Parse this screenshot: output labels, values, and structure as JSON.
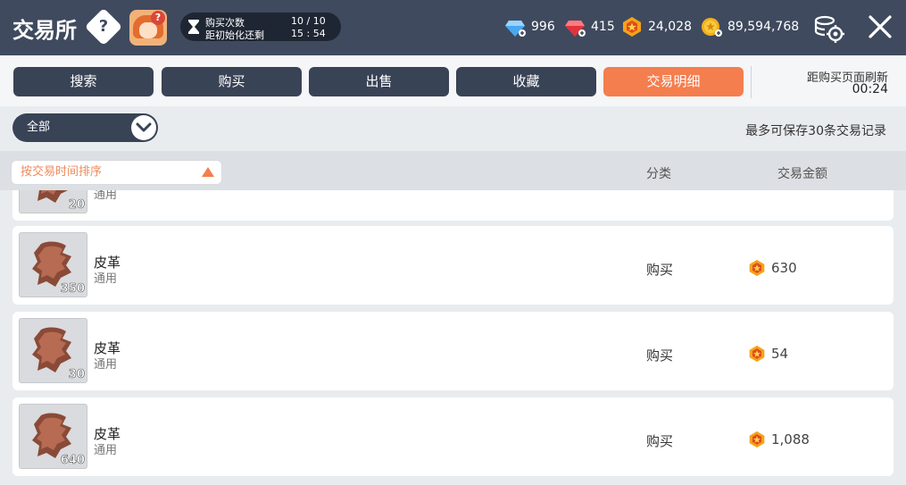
{
  "header": {
    "title": "交易所",
    "help_icon": "?",
    "counter": {
      "label1": "购买次数",
      "label2": "距初始化还剩",
      "value1": "10 / 10",
      "value2": "15 : 54"
    },
    "currencies": [
      {
        "icon": "blue-diamond-icon",
        "value": "996"
      },
      {
        "icon": "red-gem-icon",
        "value": "415"
      },
      {
        "icon": "orange-coin-icon",
        "value": "24,028"
      },
      {
        "icon": "gold-coin-icon",
        "value": "89,594,768"
      }
    ]
  },
  "tabs": [
    {
      "label": "搜索",
      "active": false
    },
    {
      "label": "购买",
      "active": false
    },
    {
      "label": "出售",
      "active": false
    },
    {
      "label": "收藏",
      "active": false
    },
    {
      "label": "交易明细",
      "active": true
    }
  ],
  "refresh": {
    "label": "距购买页面刷新",
    "time": "00:24"
  },
  "filter": {
    "selected": "全部",
    "max_note": "最多可保存30条交易记录"
  },
  "columns": {
    "sort_label": "按交易时间排序",
    "category": "分类",
    "amount": "交易金额"
  },
  "rows": [
    {
      "name": "",
      "sub": "通用",
      "qty": "20",
      "category": "",
      "amount": ""
    },
    {
      "name": "皮革",
      "sub": "通用",
      "qty": "350",
      "category": "购买",
      "amount": "630"
    },
    {
      "name": "皮革",
      "sub": "通用",
      "qty": "30",
      "category": "购买",
      "amount": "54"
    },
    {
      "name": "皮革",
      "sub": "通用",
      "qty": "640",
      "category": "购买",
      "amount": "1,088"
    }
  ],
  "colors": {
    "header_bg": "#3f4a5e",
    "tab_bg": "#394356",
    "accent": "#f47e4e"
  }
}
